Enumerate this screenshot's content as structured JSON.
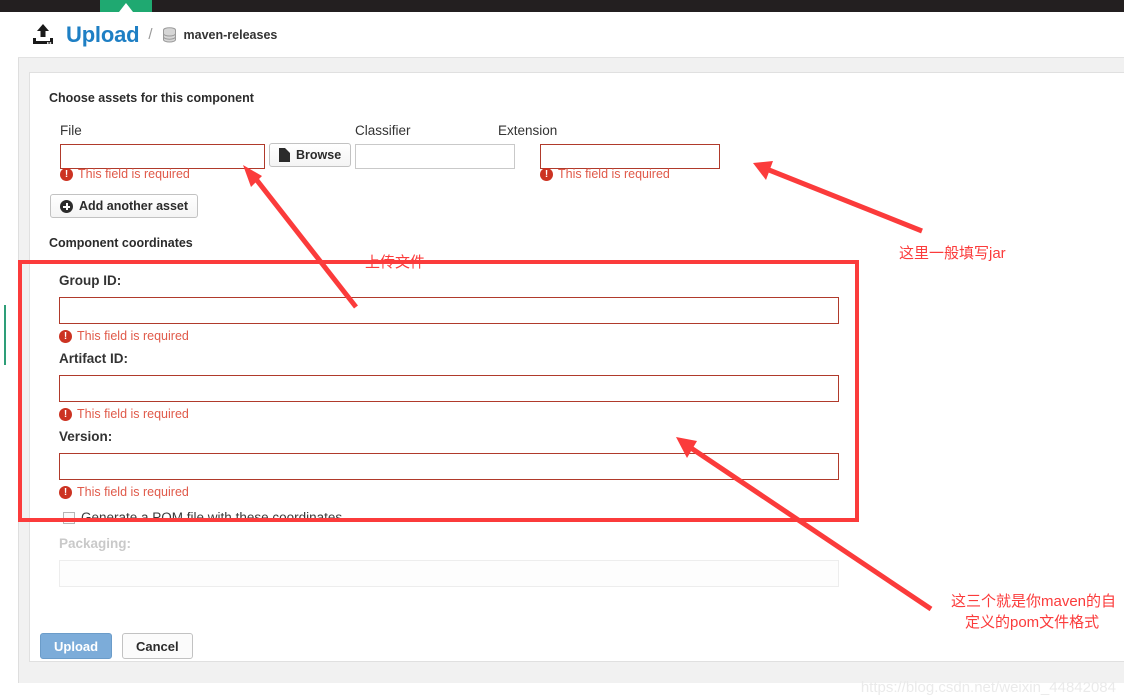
{
  "header": {
    "upload_icon": "upload-icon",
    "title": "Upload",
    "separator": "/",
    "repo_icon": "database-icon",
    "repository": "maven-releases"
  },
  "form": {
    "assets_section_title": "Choose assets for this component",
    "coordinates_section_title": "Component coordinates",
    "asset_row": {
      "file_label": "File",
      "file_value": "",
      "file_error": "This field is required",
      "browse_label": "Browse",
      "browse_icon": "file-icon",
      "classifier_label": "Classifier",
      "classifier_value": "",
      "extension_label": "Extension",
      "extension_value": "",
      "extension_error": "This field is required"
    },
    "add_asset_label": "Add another asset",
    "add_asset_icon": "plus-circle-icon",
    "fields": [
      {
        "label": "Group ID:",
        "value": "",
        "error": "This field is required"
      },
      {
        "label": "Artifact ID:",
        "value": "",
        "error": "This field is required"
      },
      {
        "label": "Version:",
        "value": "",
        "error": "This field is required"
      }
    ],
    "generate_pom_label": "Generate a POM file with these coordinates",
    "generate_pom_checked": false,
    "packaging_label": "Packaging:",
    "packaging_value": "",
    "submit_label": "Upload",
    "cancel_label": "Cancel"
  },
  "annotations": [
    {
      "name": "upload-file-note",
      "text": "上传文件"
    },
    {
      "name": "extension-jar-note",
      "text": "这里一般填写jar"
    },
    {
      "name": "pom-format-note-line1",
      "text": "这三个就是你maven的自"
    },
    {
      "name": "pom-format-note-line2",
      "text": "定义的pom文件格式"
    }
  ],
  "watermark": "https://blog.csdn.net/weixin_44842084",
  "colors": {
    "accent_blue": "#1e7fc4",
    "annotation_red": "#fb3b3b",
    "error_red": "#e05a4a",
    "topbar_black": "#231f20",
    "topbar_green": "#1fa971",
    "upload_button": "#7cacd9"
  }
}
